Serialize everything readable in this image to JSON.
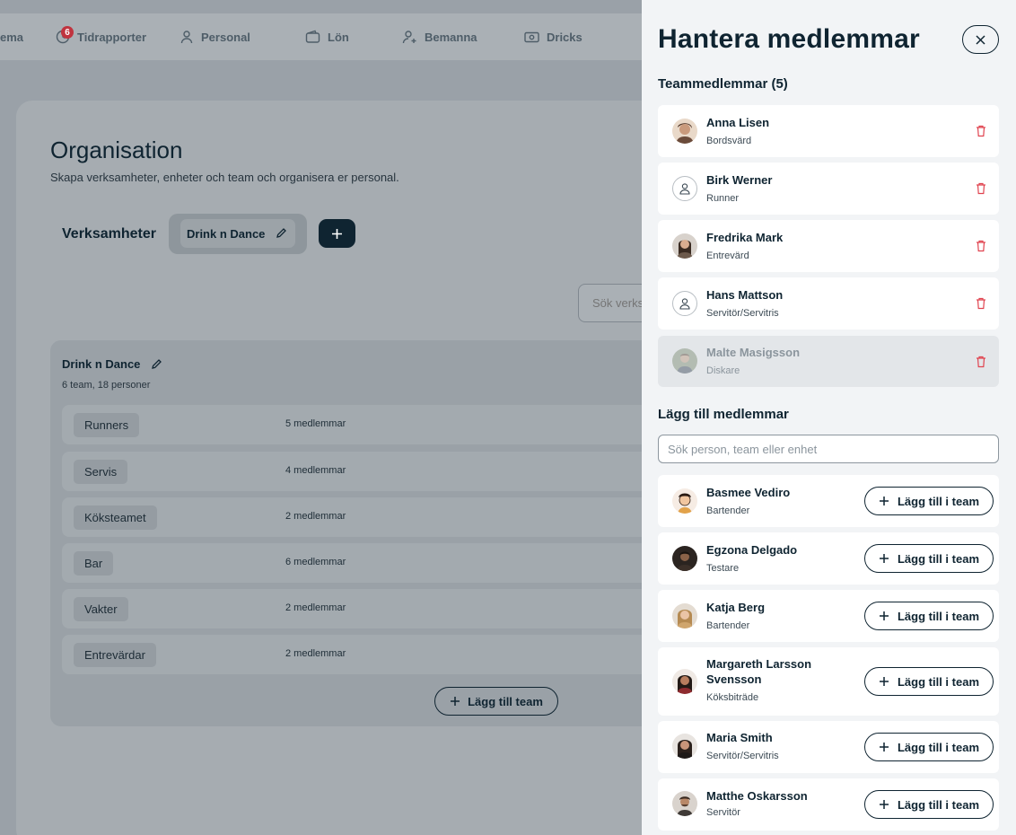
{
  "nav": {
    "items": [
      {
        "label": "ema",
        "icon": "none"
      },
      {
        "label": "Tidrapporter",
        "icon": "clock-icon",
        "badge": "6"
      },
      {
        "label": "Personal",
        "icon": "person-icon"
      },
      {
        "label": "Lön",
        "icon": "wallet-icon"
      },
      {
        "label": "Bemanna",
        "icon": "person-add-icon"
      },
      {
        "label": "Dricks",
        "icon": "cash-icon"
      }
    ]
  },
  "page": {
    "title": "Organisation",
    "subtitle": "Skapa verksamheter, enheter och team och organisera er personal.",
    "verksamheter_label": "Verksamheter",
    "verksamhet_chip": "Drink n Dance",
    "search_placeholder": "Sök verksamhet"
  },
  "org": {
    "name": "Drink n Dance",
    "meta": "6 team, 18 personer",
    "teams": [
      {
        "name": "Runners",
        "count": "5 medlemmar"
      },
      {
        "name": "Servis",
        "count": "4 medlemmar"
      },
      {
        "name": "Köksteamet",
        "count": "2 medlemmar"
      },
      {
        "name": "Bar",
        "count": "6 medlemmar"
      },
      {
        "name": "Vakter",
        "count": "2 medlemmar"
      },
      {
        "name": "Entrevärdar",
        "count": "2 medlemmar"
      }
    ],
    "add_team_label": "Lägg till team"
  },
  "drawer": {
    "title": "Hantera medlemmar",
    "members_heading": "Teammedlemmar (5)",
    "members": [
      {
        "name": "Anna Lisen",
        "role": "Bordsvärd",
        "avatar": "photo"
      },
      {
        "name": "Birk Werner",
        "role": "Runner",
        "avatar": "placeholder"
      },
      {
        "name": "Fredrika Mark",
        "role": "Entrevärd",
        "avatar": "photo"
      },
      {
        "name": "Hans Mattson",
        "role": "Servitör/Servitris",
        "avatar": "placeholder"
      },
      {
        "name": "Malte Masigsson",
        "role": "Diskare",
        "avatar": "photo",
        "disabled": true
      }
    ],
    "add_heading": "Lägg till medlemmar",
    "search_placeholder": "Sök person, team eller enhet",
    "add_button_label": "Lägg till i team",
    "candidates": [
      {
        "name": "Basmee Vediro",
        "role": "Bartender"
      },
      {
        "name": "Egzona Delgado",
        "role": "Testare"
      },
      {
        "name": "Katja Berg",
        "role": "Bartender"
      },
      {
        "name": "Margareth Larsson Svensson",
        "role": "Köksbiträde"
      },
      {
        "name": "Maria Smith",
        "role": "Servitör/Servitris"
      },
      {
        "name": "Matthe Oskarsson",
        "role": "Servitör"
      }
    ]
  },
  "colors": {
    "primary": "#0f2431",
    "danger": "#e0434f",
    "badge": "#c0343f",
    "drawer_bg": "#f2f4f6",
    "overlay": "#9aa1a8"
  }
}
